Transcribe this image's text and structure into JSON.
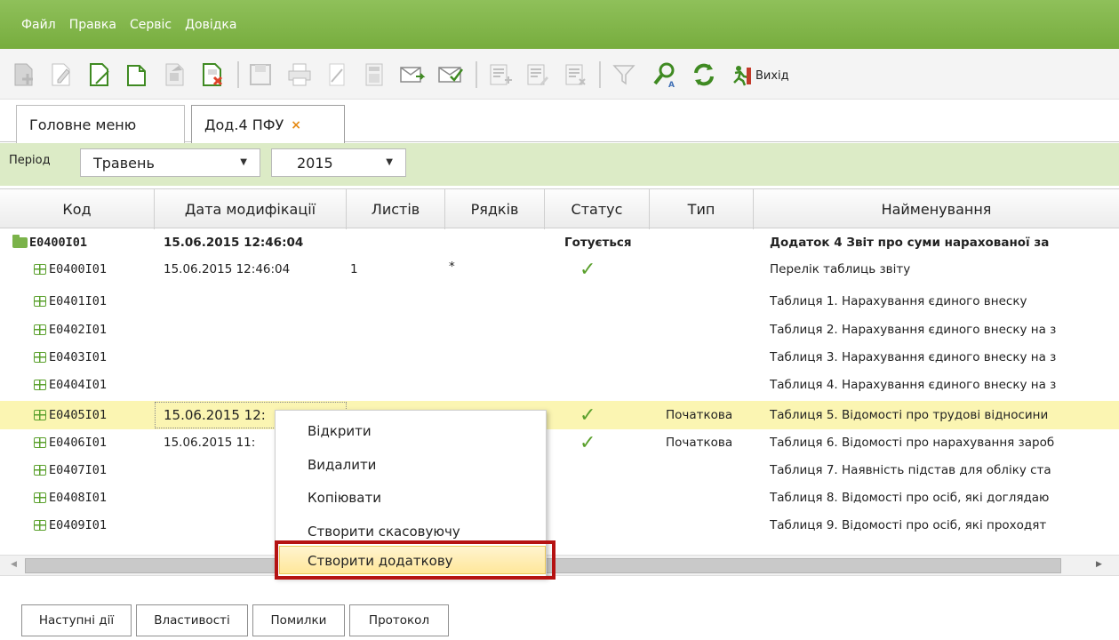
{
  "menu": [
    "Файл",
    "Правка",
    "Сервіс",
    "Довідка"
  ],
  "toolbar": {
    "buttons": [
      "doc-new-icon",
      "doc-edit-icon",
      "doc-open-icon",
      "doc-copy-icon",
      "doc-print-preview-icon",
      "doc-delete-icon",
      "save-icon",
      "print-icon",
      "sign-icon",
      "calculator-icon",
      "send-mail-icon",
      "receive-mail-icon",
      "list-add-icon",
      "list-edit-icon",
      "list-delete-icon",
      "filter-icon",
      "search-user-icon",
      "refresh-icon"
    ],
    "exit_label": "Вихід"
  },
  "tabs": [
    {
      "label": "Головне меню"
    },
    {
      "label": "Дод.4 ПФУ",
      "close": "×"
    }
  ],
  "filter": {
    "label": "Період",
    "month": "Травень",
    "year": "2015"
  },
  "grid": {
    "columns": [
      "Код",
      "Дата модифікації",
      "Листів",
      "Рядків",
      "Статус",
      "Тип",
      "Найменування"
    ],
    "rows": [
      {
        "code": "E0400I01",
        "date": "15.06.2015 12:46:04",
        "sheets": "",
        "rows": "",
        "status": "Готується",
        "type": "",
        "name": "Додаток 4 Звіт про суми нарахованої за"
      },
      {
        "code": "E0400I01",
        "date": "15.06.2015 12:46:04",
        "sheets": "1",
        "rows": "*",
        "status": "✓",
        "type": "",
        "name": "Перелік таблиць звіту"
      },
      {
        "code": "E0401I01",
        "date": "",
        "sheets": "",
        "rows": "",
        "status": "",
        "type": "",
        "name": "Таблиця 1. Нарахування єдиного внеску"
      },
      {
        "code": "E0402I01",
        "date": "",
        "sheets": "",
        "rows": "",
        "status": "",
        "type": "",
        "name": "Таблиця 2. Нарахування єдиного внеску на з"
      },
      {
        "code": "E0403I01",
        "date": "",
        "sheets": "",
        "rows": "",
        "status": "",
        "type": "",
        "name": "Таблиця 3. Нарахування єдиного внеску на з"
      },
      {
        "code": "E0404I01",
        "date": "",
        "sheets": "",
        "rows": "",
        "status": "",
        "type": "",
        "name": "Таблиця 4. Нарахування єдиного внеску на з"
      },
      {
        "code": "E0405I01",
        "date": "15.06.2015 12:",
        "sheets": "",
        "rows": "",
        "status": "✓",
        "type": "Початкова",
        "name": "Таблиця 5. Відомості про трудові відносини"
      },
      {
        "code": "E0406I01",
        "date": "15.06.2015 11:",
        "sheets": "",
        "rows": "",
        "status": "✓",
        "type": "Початкова",
        "name": "Таблиця 6. Відомості про нарахування зароб"
      },
      {
        "code": "E0407I01",
        "date": "",
        "sheets": "",
        "rows": "",
        "status": "",
        "type": "",
        "name": "Таблиця 7. Наявність підстав для обліку ста"
      },
      {
        "code": "E0408I01",
        "date": "",
        "sheets": "",
        "rows": "",
        "status": "",
        "type": "",
        "name": "Таблиця 8. Відомості про осіб, які доглядаю"
      },
      {
        "code": "E0409I01",
        "date": "",
        "sheets": "",
        "rows": "",
        "status": "",
        "type": "",
        "name": "Таблиця 9. Відомості про осіб, які проходят"
      }
    ]
  },
  "context_menu": [
    "Відкрити",
    "Видалити",
    "Копіювати",
    "Створити скасовуючу",
    "Створити додаткову"
  ],
  "bottom_tabs": [
    "Наступні дії",
    "Властивості",
    "Помилки",
    "Протокол"
  ],
  "colors": {
    "brand_green": "#77ad3e",
    "filter_bg": "#dcebc6",
    "selected_row": "#fbf5b2",
    "highlight_box": "#b51212"
  }
}
